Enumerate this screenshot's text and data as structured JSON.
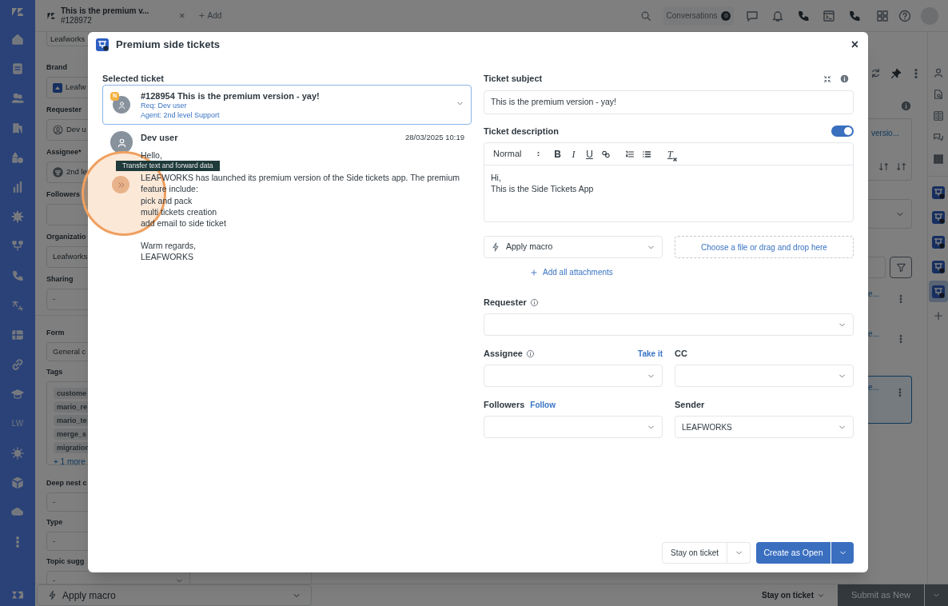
{
  "top_bar": {
    "tab": {
      "title": "This is the premium v...",
      "subtitle": "#128972",
      "close": "×"
    },
    "add_tab": "Add",
    "conversations": {
      "label": "Conversations",
      "count": "0"
    }
  },
  "nav_rail": {
    "text_item": "LW"
  },
  "left_panel": {
    "brand_tab": "Leafworks",
    "sections": [
      [
        {
          "label": "Brand",
          "kind": "brand",
          "value": "Leafw"
        },
        {
          "label": "Requester",
          "kind": "user",
          "value": "Dev u"
        },
        {
          "label": "Assignee*",
          "kind": "group",
          "value": "2nd le"
        },
        {
          "label": "Followers",
          "kind": "empty"
        },
        {
          "label": "Organizatio",
          "kind": "text",
          "value": "Leafworks"
        },
        {
          "label": "Sharing",
          "kind": "text",
          "value": "-"
        }
      ],
      [
        {
          "label": "Form",
          "kind": "text",
          "value": "General c"
        },
        {
          "label": "Tags",
          "kind": "tags",
          "tags": [
            "custome",
            "mario_re",
            "mario_te",
            "merge_s",
            "migration"
          ],
          "more": "+ 1 more"
        },
        {
          "label": "Deep nest c",
          "kind": "text",
          "value": "-"
        },
        {
          "label": "Type",
          "kind": "text",
          "value": "-"
        },
        {
          "label": "Topic sugg",
          "kind": "select",
          "value": "-"
        }
      ]
    ]
  },
  "right_panel": {
    "card_link": "versio...",
    "items": [
      {
        "text": "e...",
        "selected": false
      },
      {
        "text": "e...",
        "selected": false
      },
      {
        "text": "e...",
        "selected": true
      }
    ]
  },
  "right_rail": {
    "apps": [
      {
        "selected": false
      },
      {
        "selected": false
      },
      {
        "selected": false
      },
      {
        "selected": false
      },
      {
        "selected": true
      }
    ]
  },
  "bottom_bar": {
    "macro": "Apply macro",
    "stay": "Stay on ticket",
    "submit": "Submit as New"
  },
  "modal": {
    "title": "Premium side tickets",
    "close": "×",
    "selected_ticket": {
      "label": "Selected ticket",
      "badge": "N",
      "title": "#128954 This is the premium version - yay!",
      "requester": "Req: Dev user",
      "agent": "Agent: 2nd level Support"
    },
    "message": {
      "author": "Dev user",
      "time": "28/03/2025 10:19",
      "paragraphs": [
        [
          "Hello,"
        ],
        [
          "LEAFWORKS has launched its premium version of the Side tickets app. The premium",
          "feature include:",
          "pick and pack",
          "multi tickets creation",
          "add email to side ticket"
        ],
        [
          "Warm regards,",
          "LEAFWORKS"
        ]
      ]
    },
    "highlight": {
      "tooltip": "Transfer text and forward data"
    },
    "form": {
      "subject_label": "Ticket subject",
      "subject": "This is the premium version - yay!",
      "description_label": "Ticket description",
      "description_enabled": true,
      "format": "Normal",
      "format_buttons": [
        {
          "kind": "bold",
          "label": "B"
        },
        {
          "kind": "italic",
          "label": "I"
        },
        {
          "kind": "underline",
          "label": "U"
        }
      ],
      "clear_format": "T",
      "description_lines": [
        "Hi,",
        "This is the Side Tickets App"
      ],
      "macro": "Apply macro",
      "file_drop": "Choose a file or drag and drop here",
      "add_attachments": "Add all attachments",
      "requester_label": "Requester",
      "assignee_label": "Assignee",
      "take_it": "Take it",
      "cc_label": "CC",
      "followers_label": "Followers",
      "follow": "Follow",
      "sender_label": "Sender",
      "sender": "LEAFWORKS"
    },
    "footer": {
      "stay": "Stay on ticket",
      "create": "Create as Open"
    }
  }
}
